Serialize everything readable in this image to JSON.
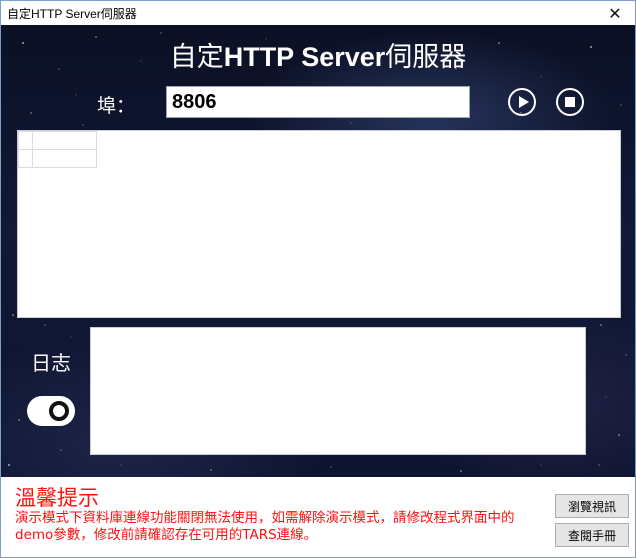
{
  "window": {
    "title": "自定HTTP Server伺服器",
    "close_glyph": "✕"
  },
  "header": {
    "title_prefix": "自定",
    "title_bold": "HTTP Server",
    "title_suffix": "伺服器"
  },
  "port": {
    "label": "埠：",
    "value": "8806"
  },
  "controls": {
    "start_icon": "play-circle-icon",
    "stop_icon": "stop-circle-icon"
  },
  "log": {
    "label": "日志",
    "toggle_on": true
  },
  "notice": {
    "title": "溫馨提示",
    "text": "演示模式下資料庫連線功能關閉無法使用，如需解除演示模式，請修改程式界面中的demo參數，修改前請確認存在可用的TARS連線。"
  },
  "buttons": {
    "browse": "瀏覽視訊",
    "manual": "查閱手冊"
  },
  "colors": {
    "notice_red": "#ff1010",
    "stage_bg": "#0b1024",
    "title_text": "#ffffff"
  }
}
